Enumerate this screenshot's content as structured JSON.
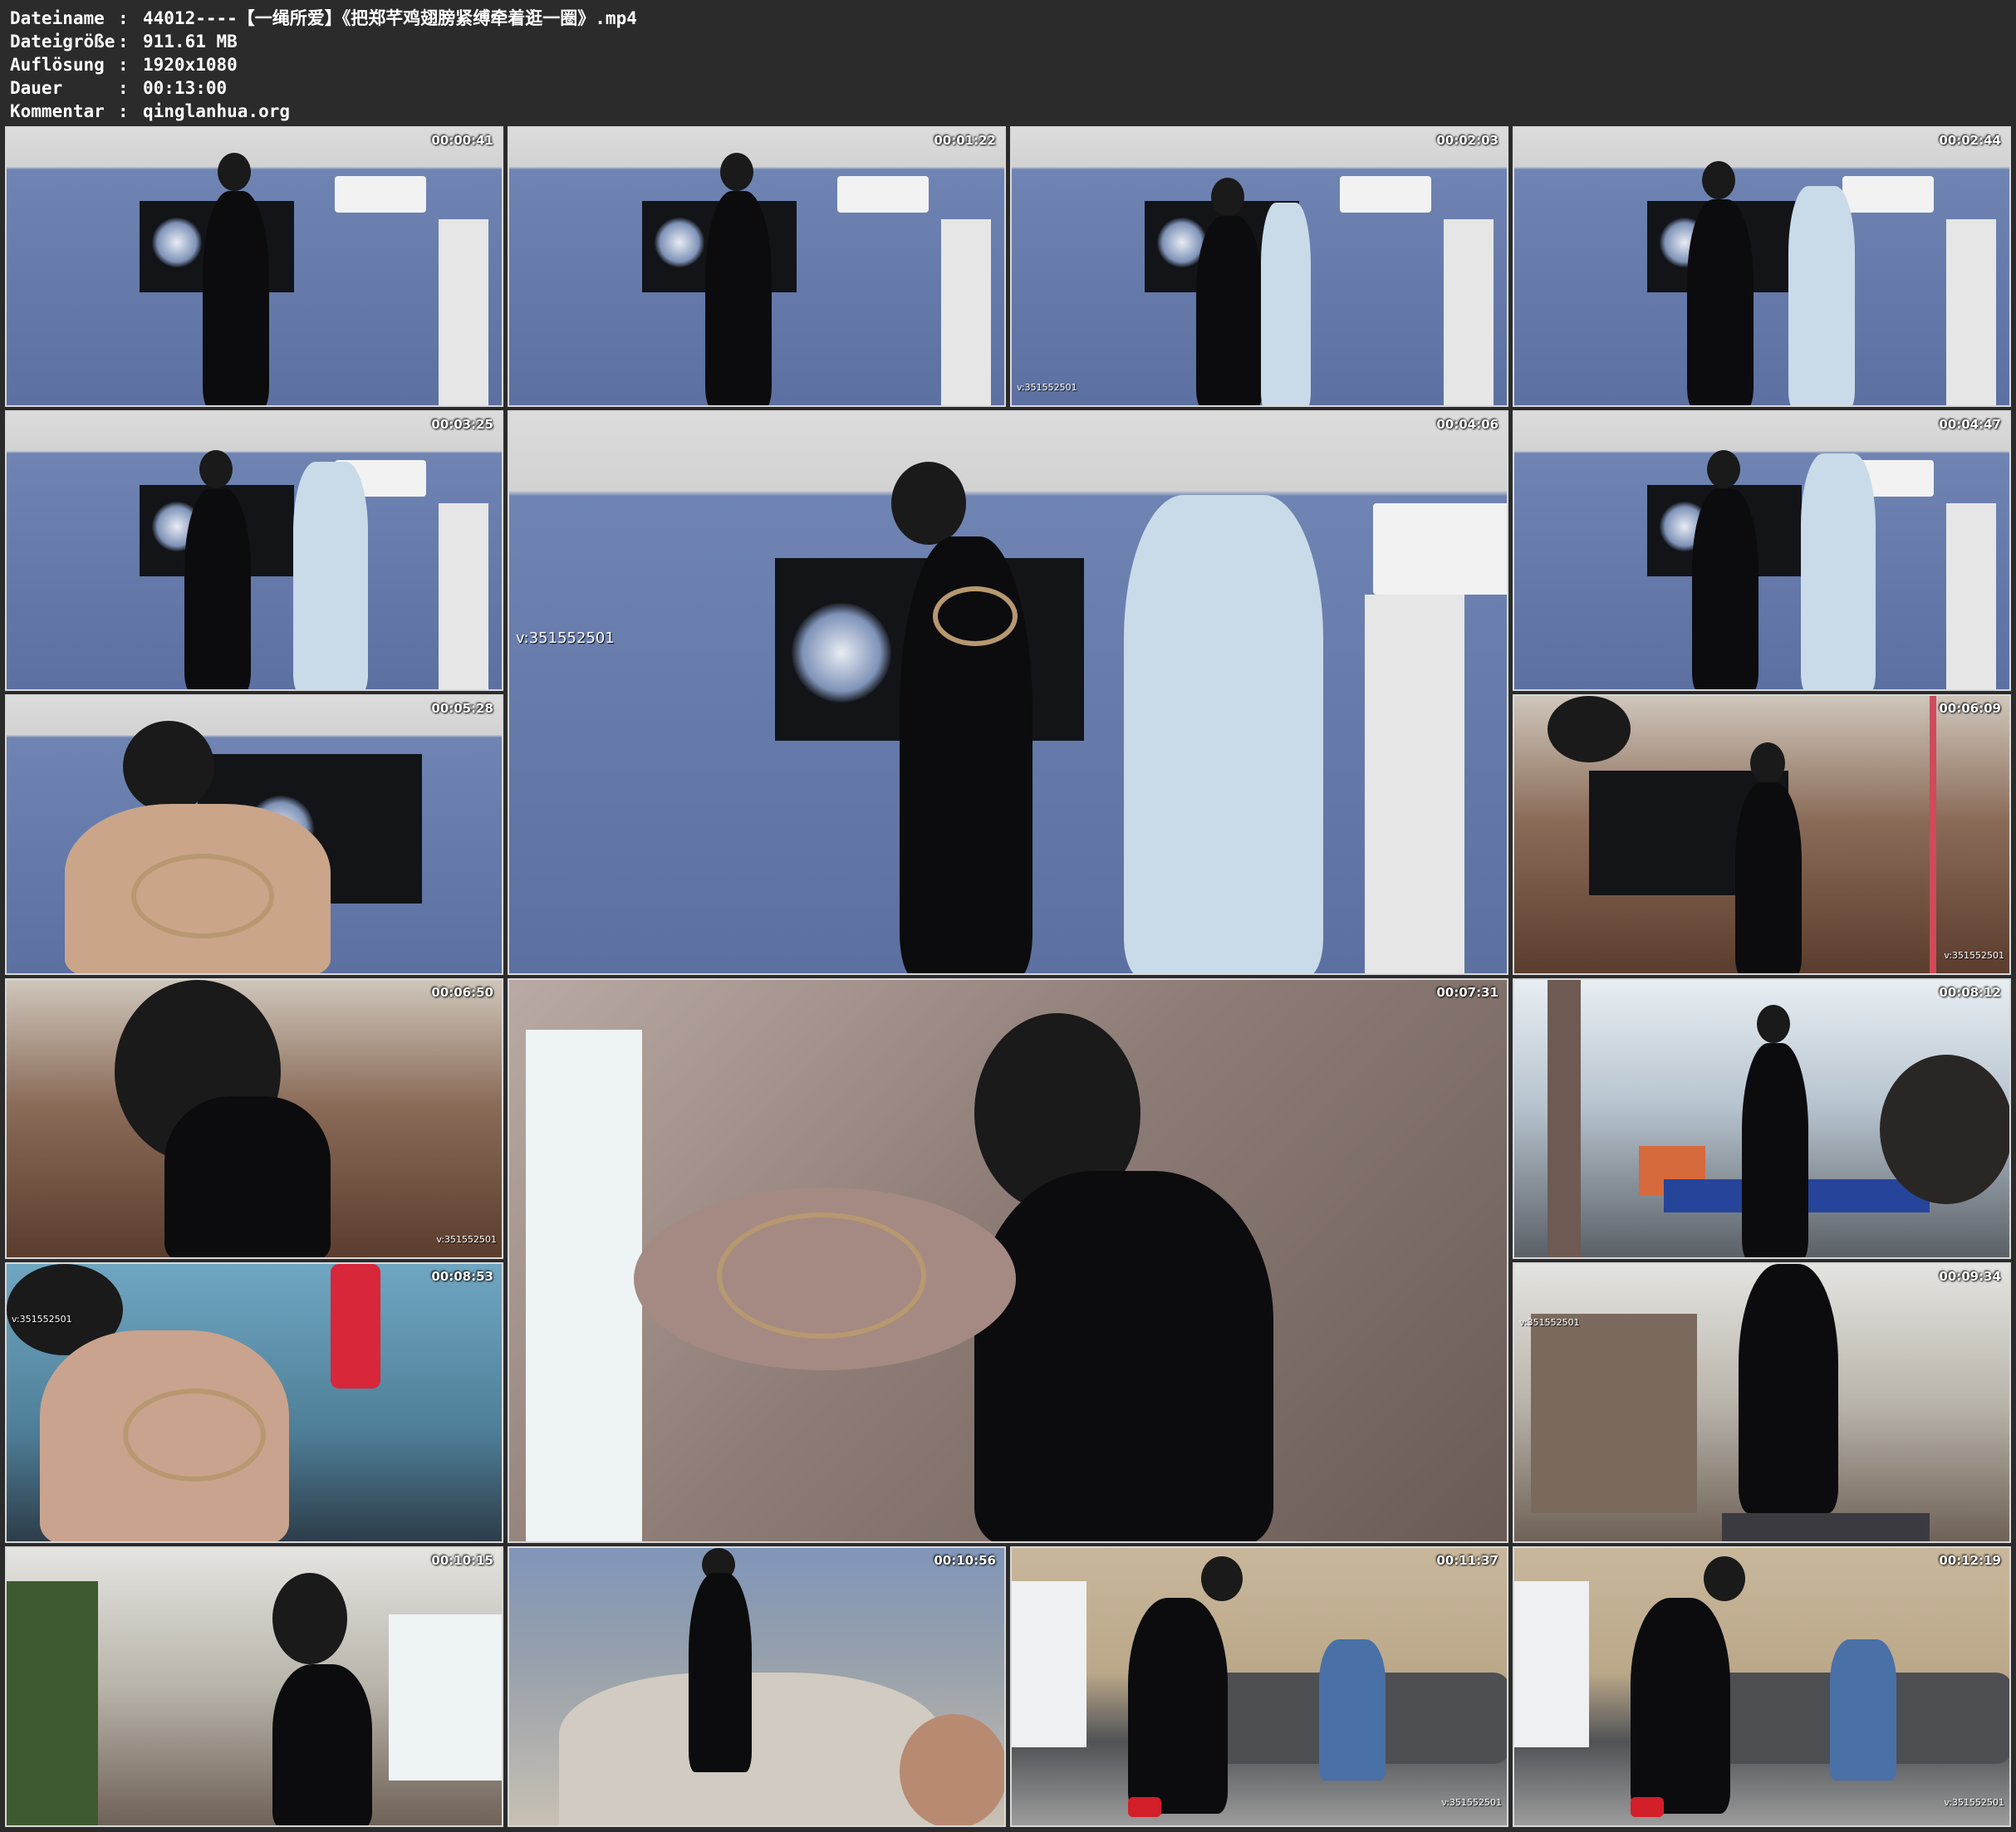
{
  "info": {
    "rows": [
      {
        "label": "Dateiname",
        "value": "44012----【一绳所爱】《把郑芊鸡翅膀紧缚牵着逛一圈》.mp4"
      },
      {
        "label": "Dateigröße",
        "value": "911.61 MB"
      },
      {
        "label": "Auflösung",
        "value": "1920x1080"
      },
      {
        "label": "Dauer",
        "value": "00:13:00"
      },
      {
        "label": "Kommentar",
        "value": "qinglanhua.org"
      }
    ],
    "separator": ":"
  },
  "watermark": "v:351552501",
  "thumbnails": [
    {
      "time": "00:00:41"
    },
    {
      "time": "00:01:22"
    },
    {
      "time": "00:02:03"
    },
    {
      "time": "00:02:44"
    },
    {
      "time": "00:03:25"
    },
    {
      "time": "00:04:06"
    },
    {
      "time": "00:04:47"
    },
    {
      "time": "00:05:28"
    },
    {
      "time": "00:06:09"
    },
    {
      "time": "00:06:50"
    },
    {
      "time": "00:07:31"
    },
    {
      "time": "00:08:12"
    },
    {
      "time": "00:08:53"
    },
    {
      "time": "00:09:34"
    },
    {
      "time": "00:10:15"
    },
    {
      "time": "00:10:56"
    },
    {
      "time": "00:11:37"
    },
    {
      "time": "00:12:19"
    }
  ]
}
